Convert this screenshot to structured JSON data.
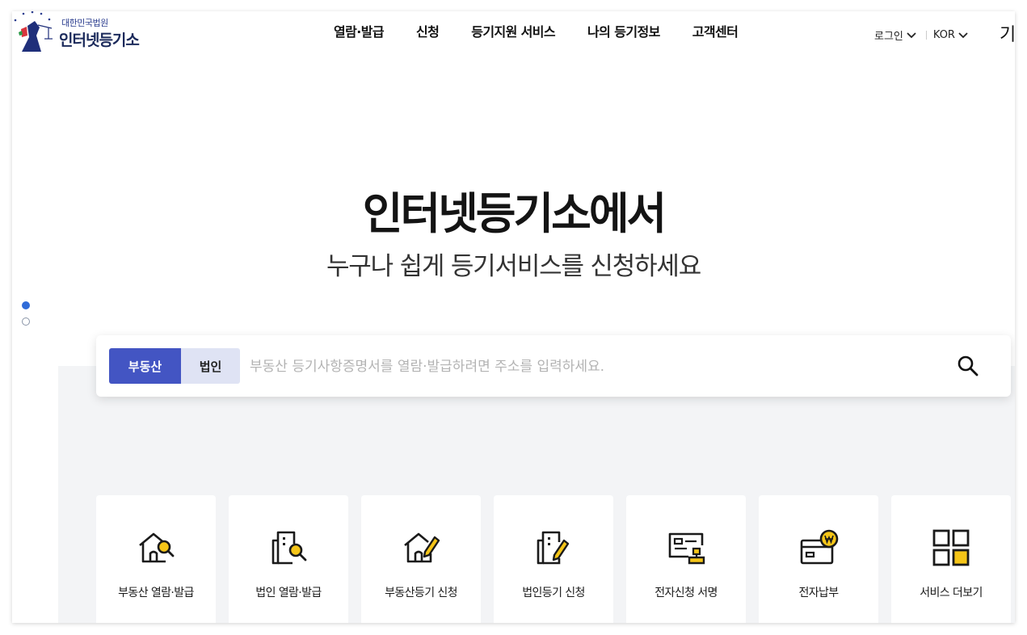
{
  "header": {
    "logo_small": "대한민국법원",
    "logo_big": "인터넷등기소",
    "nav": [
      "열람·발급",
      "신청",
      "등기지원 서비스",
      "나의 등기정보",
      "고객센터"
    ],
    "login_label": "로그인",
    "lang_label": "KOR",
    "menu_cut": "기"
  },
  "hero": {
    "title": "인터넷등기소에서",
    "subtitle": "누구나 쉽게 등기서비스를 신청하세요"
  },
  "search": {
    "tabs": [
      "부동산",
      "법인"
    ],
    "active_tab": "부동산",
    "placeholder": "부동산 등기사항증명서를 열람·발급하려면 주소를 입력하세요.",
    "value": ""
  },
  "quick_menu": [
    {
      "label": "부동산 열람·발급",
      "icon": "house-search-icon"
    },
    {
      "label": "법인 열람·발급",
      "icon": "building-search-icon"
    },
    {
      "label": "부동산등기 신청",
      "icon": "house-pen-icon"
    },
    {
      "label": "법인등기 신청",
      "icon": "document-pen-icon"
    },
    {
      "label": "전자신청 서명",
      "icon": "stamp-sign-icon"
    },
    {
      "label": "전자납부",
      "icon": "won-payment-icon"
    },
    {
      "label": "서비스 더보기",
      "icon": "grid-more-icon"
    }
  ],
  "colors": {
    "accent": "#4355c3",
    "tab_inactive": "#dfe3f4",
    "icon_yellow": "#f5c518",
    "panel_bg": "#f3f4f6",
    "dot_active": "#2f6bd8"
  },
  "slider": {
    "total": 2,
    "active_index": 1
  }
}
